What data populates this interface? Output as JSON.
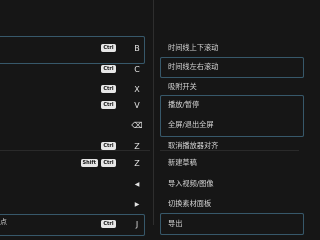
{
  "shortcuts_left": [
    {
      "badge": "Ctrl",
      "key": "B"
    },
    {
      "badge": "Ctrl",
      "key": "C"
    },
    {
      "badge": "Ctrl",
      "key": "X"
    },
    {
      "badge": "Ctrl",
      "key": "V"
    },
    {
      "badge": "",
      "key": "⌫"
    },
    {
      "badge": "Ctrl",
      "key": "Z"
    },
    {
      "badge": "Shift",
      "badge2": "Ctrl",
      "key": "Z"
    },
    {
      "badge": "",
      "key": "◀"
    },
    {
      "badge": "",
      "key": "▶"
    },
    {
      "badge": "Ctrl",
      "key": "J"
    }
  ],
  "shortcuts_right": [
    {
      "label": "时间线上下滚动"
    },
    {
      "label": "时间线左右滚动"
    },
    {
      "label": "吸附开关"
    },
    {
      "label": "播放/暂停"
    },
    {
      "label": "全屏/退出全屏"
    },
    {
      "label": "取消播放器对齐"
    },
    {
      "label": "新建草稿"
    },
    {
      "label": "导入视频/图像"
    },
    {
      "label": "切换素材面板"
    },
    {
      "label": "导出"
    }
  ],
  "left_edge_labels": [
    "点"
  ]
}
